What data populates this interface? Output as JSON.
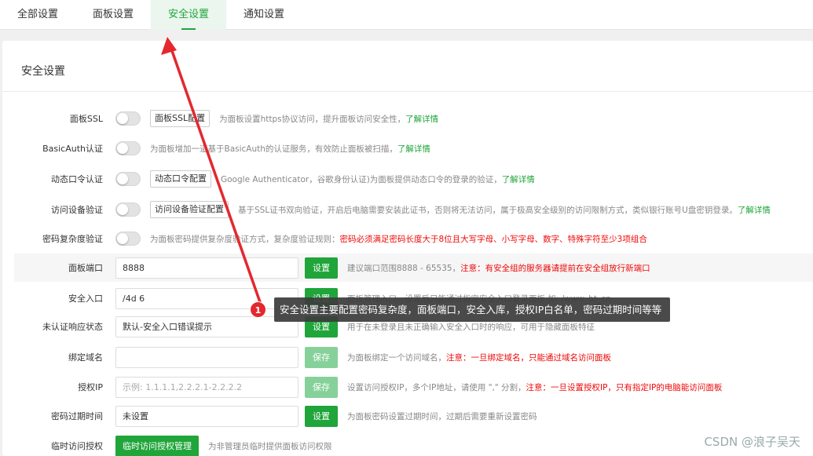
{
  "tabs": [
    {
      "label": "全部设置"
    },
    {
      "label": "面板设置"
    },
    {
      "label": "安全设置"
    },
    {
      "label": "通知设置"
    }
  ],
  "active_tab_index": 2,
  "panel": {
    "title": "安全设置"
  },
  "rows": {
    "ssl": {
      "label": "面板SSL",
      "button": "面板SSL配置",
      "desc": "为面板设置https协议访问，提升面板访问安全性，",
      "link": "了解详情",
      "enabled": false
    },
    "basicauth": {
      "label": "BasicAuth认证",
      "desc": "为面板增加一道基于BasicAuth的认证服务，有效防止面板被扫描，",
      "link": "了解详情",
      "enabled": false
    },
    "dynamic": {
      "label": "动态口令认证",
      "button": "动态口令配置",
      "desc": "Google Authenticator，谷歌身份认证)为面板提供动态口令的登录的验证，",
      "link": "了解详情",
      "enabled": false
    },
    "device": {
      "label": "访问设备验证",
      "button": "访问设备验证配置",
      "desc": "基于SSL证书双向验证，开启后电脑需要安装此证书，否则将无法访问，属于极高安全级别的访问限制方式，类似银行账号U盘密钥登录。",
      "link": "了解详情",
      "enabled": false
    },
    "complexity": {
      "label": "密码复杂度验证",
      "desc": "为面板密码提供复杂度验证方式，复杂度验证规则：",
      "warn": "密码必须满足密码长度大于8位且大写字母、小写字母、数字、特殊字符至少3项组合",
      "enabled": false
    },
    "port": {
      "label": "面板端口",
      "value": "8888",
      "button": "设置",
      "desc": "建议端口范围8888 - 65535，",
      "warn": "注意：有安全组的服务器请提前在安全组放行新端口"
    },
    "entry": {
      "label": "安全入口",
      "value": "/4d    6",
      "button": "设置",
      "desc": "面板管理入口，设置后只能通过指定安全入口登录面板,如: /www_bt_cn"
    },
    "unauth": {
      "label": "未认证响应状态",
      "value": "默认-安全入口错误提示",
      "button": "设置",
      "desc": "用于在未登录且未正确输入安全入口时的响应，可用于隐藏面板特征"
    },
    "domain": {
      "label": "绑定域名",
      "value": "",
      "button": "保存",
      "desc": "为面板绑定一个访问域名，",
      "warn": "注意：一旦绑定域名，只能通过域名访问面板"
    },
    "ip": {
      "label": "授权IP",
      "placeholder": "示例: 1.1.1.1,2.2.2.1-2.2.2.2",
      "button": "保存",
      "desc": "设置访问授权IP，多个IP地址，请使用 \",\" 分割，",
      "warn": "注意：一旦设置授权IP，只有指定IP的电脑能访问面板"
    },
    "expire": {
      "label": "密码过期时间",
      "value": "未设置",
      "button": "设置",
      "desc": "为面板密码设置过期时间，过期后需要重新设置密码"
    },
    "temp": {
      "label": "临时访问授权",
      "button": "临时访问授权管理",
      "desc": "为非管理员临时提供面板访问权限"
    }
  },
  "annotation": {
    "number": "1",
    "text": "安全设置主要配置密码复杂度，面板端口，安全入库，授权IP白名单，密码过期时间等等"
  },
  "colors": {
    "accent": "#20a53a",
    "warning": "#ef0808",
    "arrow": "#e3282e"
  },
  "watermark": "CSDN @浪子吴天"
}
